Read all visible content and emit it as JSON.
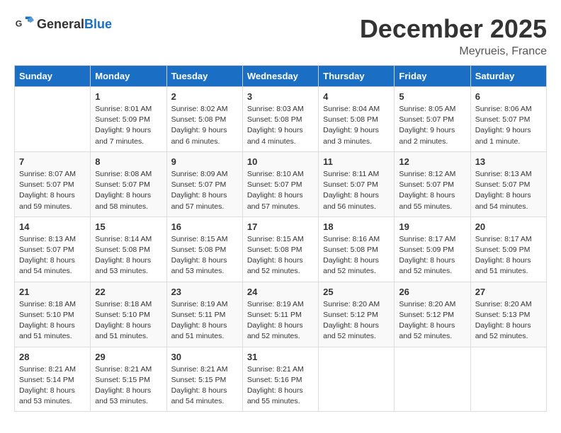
{
  "logo": {
    "general": "General",
    "blue": "Blue"
  },
  "header": {
    "month": "December 2025",
    "location": "Meyrueis, France"
  },
  "days_of_week": [
    "Sunday",
    "Monday",
    "Tuesday",
    "Wednesday",
    "Thursday",
    "Friday",
    "Saturday"
  ],
  "weeks": [
    [
      {
        "day": "",
        "info": ""
      },
      {
        "day": "1",
        "info": "Sunrise: 8:01 AM\nSunset: 5:09 PM\nDaylight: 9 hours\nand 7 minutes."
      },
      {
        "day": "2",
        "info": "Sunrise: 8:02 AM\nSunset: 5:08 PM\nDaylight: 9 hours\nand 6 minutes."
      },
      {
        "day": "3",
        "info": "Sunrise: 8:03 AM\nSunset: 5:08 PM\nDaylight: 9 hours\nand 4 minutes."
      },
      {
        "day": "4",
        "info": "Sunrise: 8:04 AM\nSunset: 5:08 PM\nDaylight: 9 hours\nand 3 minutes."
      },
      {
        "day": "5",
        "info": "Sunrise: 8:05 AM\nSunset: 5:07 PM\nDaylight: 9 hours\nand 2 minutes."
      },
      {
        "day": "6",
        "info": "Sunrise: 8:06 AM\nSunset: 5:07 PM\nDaylight: 9 hours\nand 1 minute."
      }
    ],
    [
      {
        "day": "7",
        "info": "Sunrise: 8:07 AM\nSunset: 5:07 PM\nDaylight: 8 hours\nand 59 minutes."
      },
      {
        "day": "8",
        "info": "Sunrise: 8:08 AM\nSunset: 5:07 PM\nDaylight: 8 hours\nand 58 minutes."
      },
      {
        "day": "9",
        "info": "Sunrise: 8:09 AM\nSunset: 5:07 PM\nDaylight: 8 hours\nand 57 minutes."
      },
      {
        "day": "10",
        "info": "Sunrise: 8:10 AM\nSunset: 5:07 PM\nDaylight: 8 hours\nand 57 minutes."
      },
      {
        "day": "11",
        "info": "Sunrise: 8:11 AM\nSunset: 5:07 PM\nDaylight: 8 hours\nand 56 minutes."
      },
      {
        "day": "12",
        "info": "Sunrise: 8:12 AM\nSunset: 5:07 PM\nDaylight: 8 hours\nand 55 minutes."
      },
      {
        "day": "13",
        "info": "Sunrise: 8:13 AM\nSunset: 5:07 PM\nDaylight: 8 hours\nand 54 minutes."
      }
    ],
    [
      {
        "day": "14",
        "info": "Sunrise: 8:13 AM\nSunset: 5:07 PM\nDaylight: 8 hours\nand 54 minutes."
      },
      {
        "day": "15",
        "info": "Sunrise: 8:14 AM\nSunset: 5:08 PM\nDaylight: 8 hours\nand 53 minutes."
      },
      {
        "day": "16",
        "info": "Sunrise: 8:15 AM\nSunset: 5:08 PM\nDaylight: 8 hours\nand 53 minutes."
      },
      {
        "day": "17",
        "info": "Sunrise: 8:15 AM\nSunset: 5:08 PM\nDaylight: 8 hours\nand 52 minutes."
      },
      {
        "day": "18",
        "info": "Sunrise: 8:16 AM\nSunset: 5:08 PM\nDaylight: 8 hours\nand 52 minutes."
      },
      {
        "day": "19",
        "info": "Sunrise: 8:17 AM\nSunset: 5:09 PM\nDaylight: 8 hours\nand 52 minutes."
      },
      {
        "day": "20",
        "info": "Sunrise: 8:17 AM\nSunset: 5:09 PM\nDaylight: 8 hours\nand 51 minutes."
      }
    ],
    [
      {
        "day": "21",
        "info": "Sunrise: 8:18 AM\nSunset: 5:10 PM\nDaylight: 8 hours\nand 51 minutes."
      },
      {
        "day": "22",
        "info": "Sunrise: 8:18 AM\nSunset: 5:10 PM\nDaylight: 8 hours\nand 51 minutes."
      },
      {
        "day": "23",
        "info": "Sunrise: 8:19 AM\nSunset: 5:11 PM\nDaylight: 8 hours\nand 51 minutes."
      },
      {
        "day": "24",
        "info": "Sunrise: 8:19 AM\nSunset: 5:11 PM\nDaylight: 8 hours\nand 52 minutes."
      },
      {
        "day": "25",
        "info": "Sunrise: 8:20 AM\nSunset: 5:12 PM\nDaylight: 8 hours\nand 52 minutes."
      },
      {
        "day": "26",
        "info": "Sunrise: 8:20 AM\nSunset: 5:12 PM\nDaylight: 8 hours\nand 52 minutes."
      },
      {
        "day": "27",
        "info": "Sunrise: 8:20 AM\nSunset: 5:13 PM\nDaylight: 8 hours\nand 52 minutes."
      }
    ],
    [
      {
        "day": "28",
        "info": "Sunrise: 8:21 AM\nSunset: 5:14 PM\nDaylight: 8 hours\nand 53 minutes."
      },
      {
        "day": "29",
        "info": "Sunrise: 8:21 AM\nSunset: 5:15 PM\nDaylight: 8 hours\nand 53 minutes."
      },
      {
        "day": "30",
        "info": "Sunrise: 8:21 AM\nSunset: 5:15 PM\nDaylight: 8 hours\nand 54 minutes."
      },
      {
        "day": "31",
        "info": "Sunrise: 8:21 AM\nSunset: 5:16 PM\nDaylight: 8 hours\nand 55 minutes."
      },
      {
        "day": "",
        "info": ""
      },
      {
        "day": "",
        "info": ""
      },
      {
        "day": "",
        "info": ""
      }
    ]
  ]
}
